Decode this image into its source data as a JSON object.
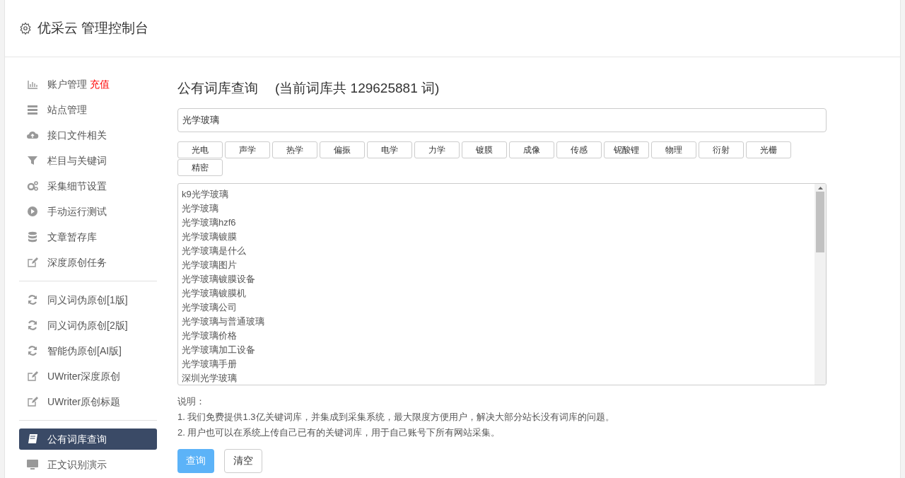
{
  "header": {
    "title": "优采云 管理控制台"
  },
  "sidebar": {
    "groups": [
      {
        "items": [
          {
            "label": "账户管理",
            "extra": "充值",
            "selected": false
          },
          {
            "label": "站点管理",
            "selected": false
          },
          {
            "label": "接口文件相关",
            "selected": false
          },
          {
            "label": "栏目与关键词",
            "selected": false
          },
          {
            "label": "采集细节设置",
            "selected": false
          },
          {
            "label": "手动运行测试",
            "selected": false
          },
          {
            "label": "文章暂存库",
            "selected": false
          },
          {
            "label": "深度原创任务",
            "selected": false
          }
        ]
      },
      {
        "items": [
          {
            "label": "同义词伪原创[1版]",
            "selected": false
          },
          {
            "label": "同义词伪原创[2版]",
            "selected": false
          },
          {
            "label": "智能伪原创[AI版]",
            "selected": false
          },
          {
            "label": "UWriter深度原创",
            "selected": false
          },
          {
            "label": "UWriter原创标题",
            "selected": false
          }
        ]
      },
      {
        "items": [
          {
            "label": "公有词库查询",
            "selected": true
          },
          {
            "label": "正文识别演示",
            "selected": false
          }
        ]
      }
    ]
  },
  "main": {
    "title": "公有词库查询",
    "count_text": "(当前词库共 129625881 词)",
    "search": {
      "value": "光学玻璃"
    },
    "tags": [
      "光电",
      "声学",
      "热学",
      "偏振",
      "电学",
      "力学",
      "镀膜",
      "成像",
      "传感",
      "铌酸锂",
      "物理",
      "衍射",
      "光栅",
      "精密"
    ],
    "results": [
      "k9光学玻璃",
      "光学玻璃",
      "光学玻璃hzf6",
      "光学玻璃镀膜",
      "光学玻璃是什么",
      "光学玻璃图片",
      "光学玻璃镀膜设备",
      "光学玻璃镀膜机",
      "光学玻璃公司",
      "光学玻璃与普通玻璃",
      "光学玻璃价格",
      "光学玻璃加工设备",
      "光学玻璃手册",
      "深圳光学玻璃"
    ],
    "notes": {
      "heading": "说明：",
      "lines": [
        "1. 我们免费提供1.3亿关键词库，并集成到采集系统，最大限度方便用户，解决大部分站长没有词库的问题。",
        "2. 用户也可以在系统上传自己已有的关键词库，用于自己账号下所有网站采集。"
      ]
    },
    "buttons": [
      {
        "label": "查询",
        "kind": "primary"
      },
      {
        "label": "清空",
        "kind": "default"
      }
    ]
  }
}
